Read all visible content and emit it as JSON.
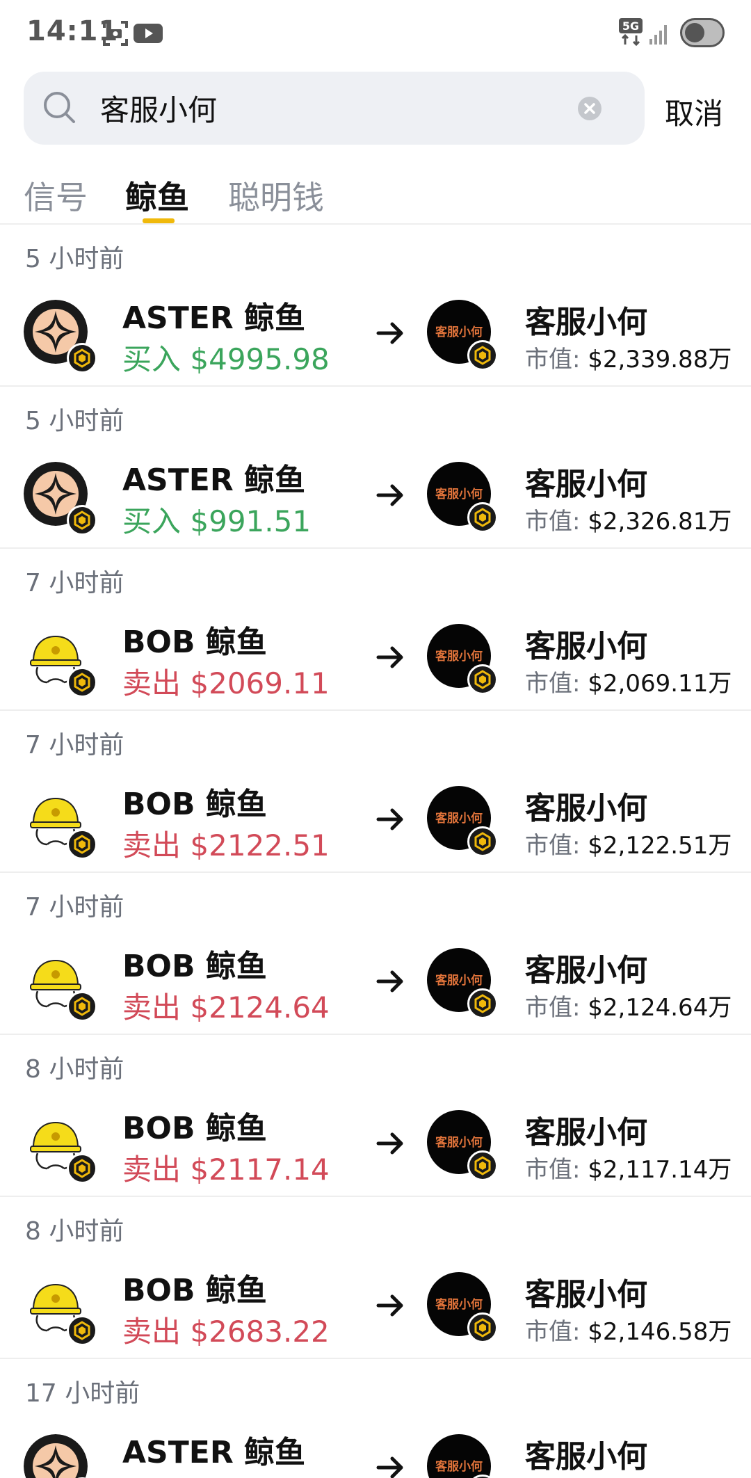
{
  "status_bar": {
    "time": "14:11",
    "icons": [
      "screenshot-icon",
      "youtube-icon",
      "5g-icon",
      "signal-icon",
      "toggle-icon"
    ]
  },
  "search": {
    "query": "客服小何",
    "placeholder": "",
    "cancel_label": "取消"
  },
  "tabs": [
    {
      "label": "信号",
      "active": false
    },
    {
      "label": "鲸鱼",
      "active": true
    },
    {
      "label": "聪明钱",
      "active": false
    }
  ],
  "colors": {
    "buy": "#3ba55c",
    "sell": "#d24a58",
    "accent": "#f0b90b",
    "search_bg": "#eef0f4"
  },
  "feed": [
    {
      "time": "5 小时前",
      "whale": "ASTER 鲸鱼",
      "whale_avatar": "aster",
      "action": "买入",
      "amount": "$4995.98",
      "side": "buy",
      "token": "客服小何",
      "token_avatar_text": "客服小何",
      "mcap_label": "市值:",
      "mcap": "$2,339.88万"
    },
    {
      "time": "5 小时前",
      "whale": "ASTER 鲸鱼",
      "whale_avatar": "aster",
      "action": "买入",
      "amount": "$991.51",
      "side": "buy",
      "token": "客服小何",
      "token_avatar_text": "客服小何",
      "mcap_label": "市值:",
      "mcap": "$2,326.81万"
    },
    {
      "time": "7 小时前",
      "whale": "BOB 鲸鱼",
      "whale_avatar": "bob",
      "action": "卖出",
      "amount": "$2069.11",
      "side": "sell",
      "token": "客服小何",
      "token_avatar_text": "客服小何",
      "mcap_label": "市值:",
      "mcap": "$2,069.11万"
    },
    {
      "time": "7 小时前",
      "whale": "BOB 鲸鱼",
      "whale_avatar": "bob",
      "action": "卖出",
      "amount": "$2122.51",
      "side": "sell",
      "token": "客服小何",
      "token_avatar_text": "客服小何",
      "mcap_label": "市值:",
      "mcap": "$2,122.51万"
    },
    {
      "time": "7 小时前",
      "whale": "BOB 鲸鱼",
      "whale_avatar": "bob",
      "action": "卖出",
      "amount": "$2124.64",
      "side": "sell",
      "token": "客服小何",
      "token_avatar_text": "客服小何",
      "mcap_label": "市值:",
      "mcap": "$2,124.64万"
    },
    {
      "time": "8 小时前",
      "whale": "BOB 鲸鱼",
      "whale_avatar": "bob",
      "action": "卖出",
      "amount": "$2117.14",
      "side": "sell",
      "token": "客服小何",
      "token_avatar_text": "客服小何",
      "mcap_label": "市值:",
      "mcap": "$2,117.14万"
    },
    {
      "time": "8 小时前",
      "whale": "BOB 鲸鱼",
      "whale_avatar": "bob",
      "action": "卖出",
      "amount": "$2683.22",
      "side": "sell",
      "token": "客服小何",
      "token_avatar_text": "客服小何",
      "mcap_label": "市值:",
      "mcap": "$2,146.58万"
    },
    {
      "time": "17 小时前",
      "whale": "ASTER 鲸鱼",
      "whale_avatar": "aster",
      "action": "",
      "amount": "",
      "side": "buy",
      "token": "客服小何",
      "token_avatar_text": "客服小何",
      "mcap_label": "",
      "mcap": ""
    }
  ]
}
